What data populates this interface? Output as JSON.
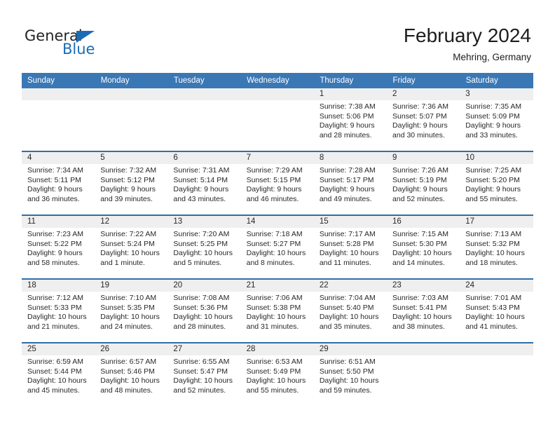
{
  "brand": {
    "name_top": "General",
    "name_bottom": "Blue",
    "triangle_icon": "triangle-icon",
    "color": "#1b6cb5"
  },
  "header": {
    "title": "February 2024",
    "subtitle": "Mehring, Germany"
  },
  "colors": {
    "header_blue": "#3a77b5",
    "row_divider_blue": "#2f6fa8",
    "day_band_gray": "#efefef",
    "text": "#282828"
  },
  "weekday_headers": [
    "Sunday",
    "Monday",
    "Tuesday",
    "Wednesday",
    "Thursday",
    "Friday",
    "Saturday"
  ],
  "labels": {
    "sunrise_prefix": "Sunrise:",
    "sunset_prefix": "Sunset:",
    "daylight_prefix": "Daylight:"
  },
  "weeks": [
    [
      {
        "day": "",
        "sunrise": "",
        "sunset": "",
        "daylight_line1": "",
        "daylight_line2": ""
      },
      {
        "day": "",
        "sunrise": "",
        "sunset": "",
        "daylight_line1": "",
        "daylight_line2": ""
      },
      {
        "day": "",
        "sunrise": "",
        "sunset": "",
        "daylight_line1": "",
        "daylight_line2": ""
      },
      {
        "day": "",
        "sunrise": "",
        "sunset": "",
        "daylight_line1": "",
        "daylight_line2": ""
      },
      {
        "day": "1",
        "sunrise": "Sunrise: 7:38 AM",
        "sunset": "Sunset: 5:06 PM",
        "daylight_line1": "Daylight: 9 hours",
        "daylight_line2": "and 28 minutes."
      },
      {
        "day": "2",
        "sunrise": "Sunrise: 7:36 AM",
        "sunset": "Sunset: 5:07 PM",
        "daylight_line1": "Daylight: 9 hours",
        "daylight_line2": "and 30 minutes."
      },
      {
        "day": "3",
        "sunrise": "Sunrise: 7:35 AM",
        "sunset": "Sunset: 5:09 PM",
        "daylight_line1": "Daylight: 9 hours",
        "daylight_line2": "and 33 minutes."
      }
    ],
    [
      {
        "day": "4",
        "sunrise": "Sunrise: 7:34 AM",
        "sunset": "Sunset: 5:11 PM",
        "daylight_line1": "Daylight: 9 hours",
        "daylight_line2": "and 36 minutes."
      },
      {
        "day": "5",
        "sunrise": "Sunrise: 7:32 AM",
        "sunset": "Sunset: 5:12 PM",
        "daylight_line1": "Daylight: 9 hours",
        "daylight_line2": "and 39 minutes."
      },
      {
        "day": "6",
        "sunrise": "Sunrise: 7:31 AM",
        "sunset": "Sunset: 5:14 PM",
        "daylight_line1": "Daylight: 9 hours",
        "daylight_line2": "and 43 minutes."
      },
      {
        "day": "7",
        "sunrise": "Sunrise: 7:29 AM",
        "sunset": "Sunset: 5:15 PM",
        "daylight_line1": "Daylight: 9 hours",
        "daylight_line2": "and 46 minutes."
      },
      {
        "day": "8",
        "sunrise": "Sunrise: 7:28 AM",
        "sunset": "Sunset: 5:17 PM",
        "daylight_line1": "Daylight: 9 hours",
        "daylight_line2": "and 49 minutes."
      },
      {
        "day": "9",
        "sunrise": "Sunrise: 7:26 AM",
        "sunset": "Sunset: 5:19 PM",
        "daylight_line1": "Daylight: 9 hours",
        "daylight_line2": "and 52 minutes."
      },
      {
        "day": "10",
        "sunrise": "Sunrise: 7:25 AM",
        "sunset": "Sunset: 5:20 PM",
        "daylight_line1": "Daylight: 9 hours",
        "daylight_line2": "and 55 minutes."
      }
    ],
    [
      {
        "day": "11",
        "sunrise": "Sunrise: 7:23 AM",
        "sunset": "Sunset: 5:22 PM",
        "daylight_line1": "Daylight: 9 hours",
        "daylight_line2": "and 58 minutes."
      },
      {
        "day": "12",
        "sunrise": "Sunrise: 7:22 AM",
        "sunset": "Sunset: 5:24 PM",
        "daylight_line1": "Daylight: 10 hours",
        "daylight_line2": "and 1 minute."
      },
      {
        "day": "13",
        "sunrise": "Sunrise: 7:20 AM",
        "sunset": "Sunset: 5:25 PM",
        "daylight_line1": "Daylight: 10 hours",
        "daylight_line2": "and 5 minutes."
      },
      {
        "day": "14",
        "sunrise": "Sunrise: 7:18 AM",
        "sunset": "Sunset: 5:27 PM",
        "daylight_line1": "Daylight: 10 hours",
        "daylight_line2": "and 8 minutes."
      },
      {
        "day": "15",
        "sunrise": "Sunrise: 7:17 AM",
        "sunset": "Sunset: 5:28 PM",
        "daylight_line1": "Daylight: 10 hours",
        "daylight_line2": "and 11 minutes."
      },
      {
        "day": "16",
        "sunrise": "Sunrise: 7:15 AM",
        "sunset": "Sunset: 5:30 PM",
        "daylight_line1": "Daylight: 10 hours",
        "daylight_line2": "and 14 minutes."
      },
      {
        "day": "17",
        "sunrise": "Sunrise: 7:13 AM",
        "sunset": "Sunset: 5:32 PM",
        "daylight_line1": "Daylight: 10 hours",
        "daylight_line2": "and 18 minutes."
      }
    ],
    [
      {
        "day": "18",
        "sunrise": "Sunrise: 7:12 AM",
        "sunset": "Sunset: 5:33 PM",
        "daylight_line1": "Daylight: 10 hours",
        "daylight_line2": "and 21 minutes."
      },
      {
        "day": "19",
        "sunrise": "Sunrise: 7:10 AM",
        "sunset": "Sunset: 5:35 PM",
        "daylight_line1": "Daylight: 10 hours",
        "daylight_line2": "and 24 minutes."
      },
      {
        "day": "20",
        "sunrise": "Sunrise: 7:08 AM",
        "sunset": "Sunset: 5:36 PM",
        "daylight_line1": "Daylight: 10 hours",
        "daylight_line2": "and 28 minutes."
      },
      {
        "day": "21",
        "sunrise": "Sunrise: 7:06 AM",
        "sunset": "Sunset: 5:38 PM",
        "daylight_line1": "Daylight: 10 hours",
        "daylight_line2": "and 31 minutes."
      },
      {
        "day": "22",
        "sunrise": "Sunrise: 7:04 AM",
        "sunset": "Sunset: 5:40 PM",
        "daylight_line1": "Daylight: 10 hours",
        "daylight_line2": "and 35 minutes."
      },
      {
        "day": "23",
        "sunrise": "Sunrise: 7:03 AM",
        "sunset": "Sunset: 5:41 PM",
        "daylight_line1": "Daylight: 10 hours",
        "daylight_line2": "and 38 minutes."
      },
      {
        "day": "24",
        "sunrise": "Sunrise: 7:01 AM",
        "sunset": "Sunset: 5:43 PM",
        "daylight_line1": "Daylight: 10 hours",
        "daylight_line2": "and 41 minutes."
      }
    ],
    [
      {
        "day": "25",
        "sunrise": "Sunrise: 6:59 AM",
        "sunset": "Sunset: 5:44 PM",
        "daylight_line1": "Daylight: 10 hours",
        "daylight_line2": "and 45 minutes."
      },
      {
        "day": "26",
        "sunrise": "Sunrise: 6:57 AM",
        "sunset": "Sunset: 5:46 PM",
        "daylight_line1": "Daylight: 10 hours",
        "daylight_line2": "and 48 minutes."
      },
      {
        "day": "27",
        "sunrise": "Sunrise: 6:55 AM",
        "sunset": "Sunset: 5:47 PM",
        "daylight_line1": "Daylight: 10 hours",
        "daylight_line2": "and 52 minutes."
      },
      {
        "day": "28",
        "sunrise": "Sunrise: 6:53 AM",
        "sunset": "Sunset: 5:49 PM",
        "daylight_line1": "Daylight: 10 hours",
        "daylight_line2": "and 55 minutes."
      },
      {
        "day": "29",
        "sunrise": "Sunrise: 6:51 AM",
        "sunset": "Sunset: 5:50 PM",
        "daylight_line1": "Daylight: 10 hours",
        "daylight_line2": "and 59 minutes."
      },
      {
        "day": "",
        "sunrise": "",
        "sunset": "",
        "daylight_line1": "",
        "daylight_line2": ""
      },
      {
        "day": "",
        "sunrise": "",
        "sunset": "",
        "daylight_line1": "",
        "daylight_line2": ""
      }
    ]
  ]
}
